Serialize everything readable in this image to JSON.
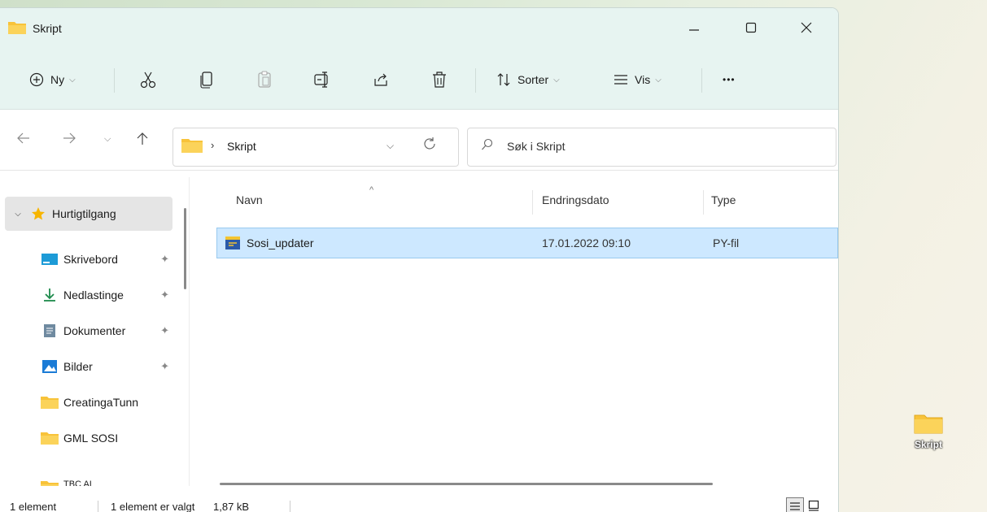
{
  "window": {
    "title": "Skript"
  },
  "toolbar": {
    "new_label": "Ny",
    "sort_label": "Sorter",
    "view_label": "Vis",
    "more_label": "•••"
  },
  "address": {
    "crumb": "Skript",
    "separator": "›"
  },
  "search": {
    "placeholder": "Søk i Skript"
  },
  "columns": {
    "name": "Navn",
    "date": "Endringsdato",
    "type": "Type"
  },
  "files": [
    {
      "name": "Sosi_updater",
      "date": "17.01.2022 09:10",
      "type": "PY-fil"
    }
  ],
  "sidebar": {
    "items": [
      {
        "label": "Hurtigtilgang"
      },
      {
        "label": "Skrivebord"
      },
      {
        "label": "Nedlastinge"
      },
      {
        "label": "Dokumenter"
      },
      {
        "label": "Bilder"
      },
      {
        "label": "CreatingaTunn"
      },
      {
        "label": "GML SOSI"
      },
      {
        "label": "TBC AI"
      }
    ]
  },
  "status": {
    "count": "1 element",
    "selected": "1 element er valgt",
    "size": "1,87 kB"
  },
  "desktop": {
    "icon_label": "Skript"
  },
  "colors": {
    "accent_bg": "#e7f4f1",
    "selection": "#cde8ff",
    "folder": "#f8c33a"
  }
}
